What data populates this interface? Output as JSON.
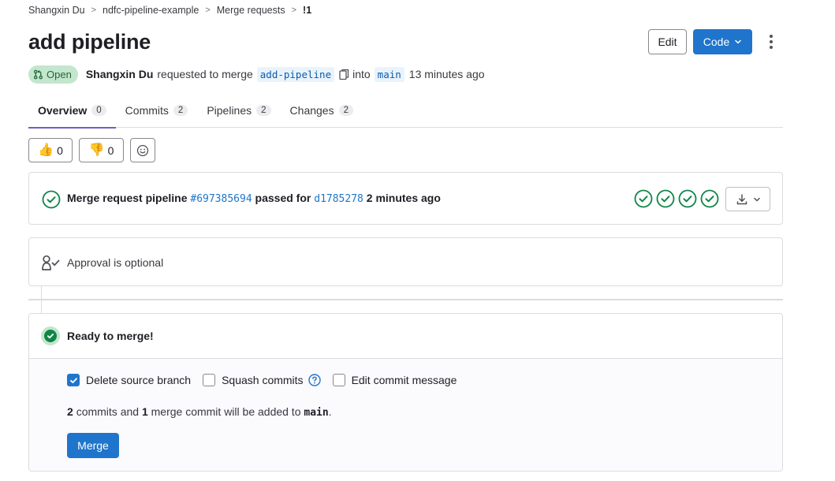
{
  "breadcrumb": {
    "items": [
      "Shangxin Du",
      "ndfc-pipeline-example",
      "Merge requests"
    ],
    "current": "!1"
  },
  "title": "add pipeline",
  "header": {
    "edit_label": "Edit",
    "code_label": "Code"
  },
  "meta": {
    "status": "Open",
    "author": "Shangxin Du",
    "action": "requested to merge",
    "source_branch": "add-pipeline",
    "into": "into",
    "target_branch": "main",
    "time": "13 minutes ago"
  },
  "tabs": [
    {
      "label": "Overview",
      "count": "0"
    },
    {
      "label": "Commits",
      "count": "2"
    },
    {
      "label": "Pipelines",
      "count": "2"
    },
    {
      "label": "Changes",
      "count": "2"
    }
  ],
  "awards": {
    "thumbsup_count": "0",
    "thumbsdown_count": "0"
  },
  "pipeline": {
    "prefix": "Merge request pipeline",
    "id": "#697385694",
    "passed_for": "passed for",
    "commit": "d1785278",
    "time": "2 minutes ago",
    "stages": [
      "passed",
      "passed",
      "passed",
      "passed"
    ]
  },
  "approval": {
    "text": "Approval is optional"
  },
  "merge": {
    "ready_text": "Ready to merge!",
    "options": [
      {
        "label": "Delete source branch",
        "checked": true
      },
      {
        "label": "Squash commits",
        "checked": false
      },
      {
        "label": "Edit commit message",
        "checked": false
      }
    ],
    "info": {
      "commits_count": "2",
      "commits_text": "commits and",
      "merge_count": "1",
      "merge_text": "merge commit will be added to",
      "target": "main",
      "end": "."
    },
    "button_label": "Merge"
  },
  "colors": {
    "primary": "#1f75cb",
    "success": "#108548",
    "tab_underline": "#6e5fc3",
    "open_badge_bg": "#c3e6cd"
  }
}
